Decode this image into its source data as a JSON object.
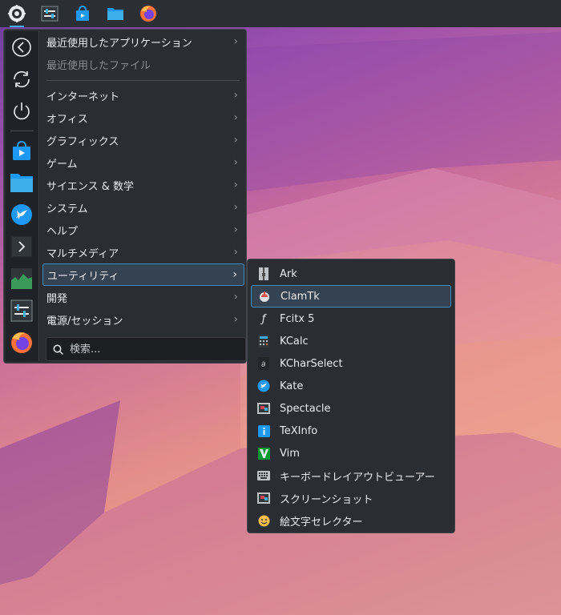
{
  "menu": {
    "categories": [
      {
        "label": "最近使用したアプリケーション"
      },
      {
        "label": "最近使用したファイル"
      },
      {
        "label": "インターネット"
      },
      {
        "label": "オフィス"
      },
      {
        "label": "グラフィックス"
      },
      {
        "label": "ゲーム"
      },
      {
        "label": "サイエンス & 数学"
      },
      {
        "label": "システム"
      },
      {
        "label": "ヘルプ"
      },
      {
        "label": "マルチメディア"
      },
      {
        "label": "ユーティリティ"
      },
      {
        "label": "開発"
      },
      {
        "label": "電源/セッション"
      }
    ],
    "arrow": "›",
    "search_placeholder": "検索..."
  },
  "submenu": {
    "items": [
      {
        "label": "Ark"
      },
      {
        "label": "ClamTk"
      },
      {
        "label": "Fcitx 5"
      },
      {
        "label": "KCalc"
      },
      {
        "label": "KCharSelect"
      },
      {
        "label": "Kate"
      },
      {
        "label": "Spectacle"
      },
      {
        "label": "TeXInfo"
      },
      {
        "label": "Vim"
      },
      {
        "label": "キーボードレイアウトビューアー"
      },
      {
        "label": "スクリーンショット"
      },
      {
        "label": "絵文字セレクター"
      }
    ]
  },
  "colors": {
    "accent": "#3daee9",
    "selection": "#354252",
    "panel": "#2b2e33",
    "menu": "#2a2d32"
  }
}
